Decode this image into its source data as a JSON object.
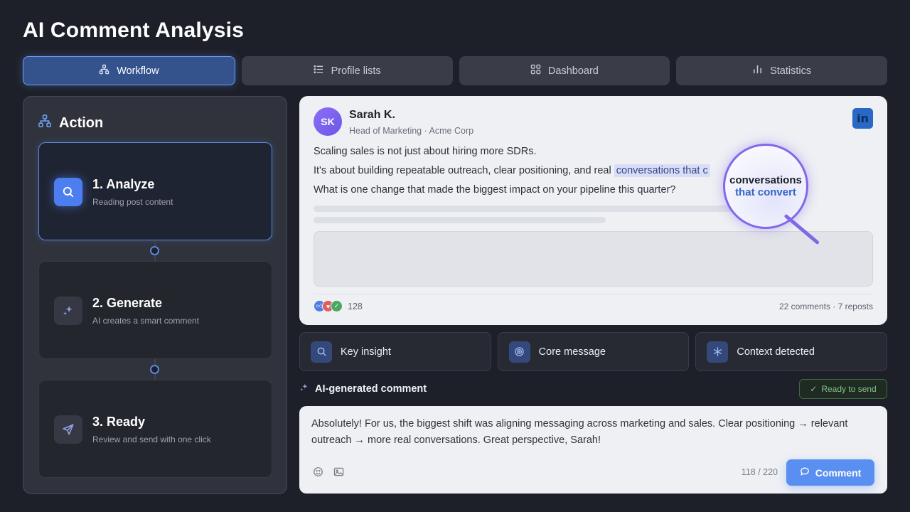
{
  "app": {
    "title": "AI Comment Analysis"
  },
  "tabs": [
    {
      "label": "Workflow",
      "icon": "workflow-icon",
      "active": true
    },
    {
      "label": "Profile lists",
      "icon": "list-icon",
      "active": false
    },
    {
      "label": "Dashboard",
      "icon": "grid-icon",
      "active": false
    },
    {
      "label": "Statistics",
      "icon": "bar-chart-icon",
      "active": false
    }
  ],
  "sidebar": {
    "heading": "Action",
    "steps": [
      {
        "title": "1. Analyze",
        "subtitle": "Reading post content",
        "icon": "search-icon",
        "active": true
      },
      {
        "title": "2. Generate",
        "subtitle": "AI creates a smart comment",
        "icon": "sparkle-icon",
        "active": false
      },
      {
        "title": "3. Ready",
        "subtitle": "Review and send with one click",
        "icon": "send-icon",
        "active": false
      }
    ]
  },
  "post": {
    "avatar_initials": "SK",
    "author": "Sarah K.",
    "role": "Head of Marketing · Acme Corp",
    "network_badge": "in",
    "line1": "Scaling sales is not just about hiring more SDRs.",
    "line2_prefix": "It's about building repeatable outreach, clear positioning, and real ",
    "line2_highlight": "conversations that c",
    "line3": "What is one change that made the biggest impact on your pipeline this quarter?",
    "reaction_count": "128",
    "engagement": "22 comments · 7 reposts",
    "magnifier_line1": "conversations",
    "magnifier_line2": "that convert"
  },
  "insights": [
    {
      "label": "Key insight",
      "icon": "search-icon"
    },
    {
      "label": "Core message",
      "icon": "target-icon"
    },
    {
      "label": "Context detected",
      "icon": "asterisk-icon"
    }
  ],
  "ai_comment": {
    "label": "AI-generated comment",
    "status": "Ready to send",
    "text": "Absolutely! For us, the biggest shift was aligning messaging across marketing and sales. Clear positioning → relevant outreach → more real conversations. Great perspective, Sarah!",
    "char_count": "118 / 220",
    "button_label": "Comment"
  },
  "colors": {
    "accent": "#5a8ff2",
    "ready": "#7fc488",
    "magnifier": "#8367ea"
  }
}
